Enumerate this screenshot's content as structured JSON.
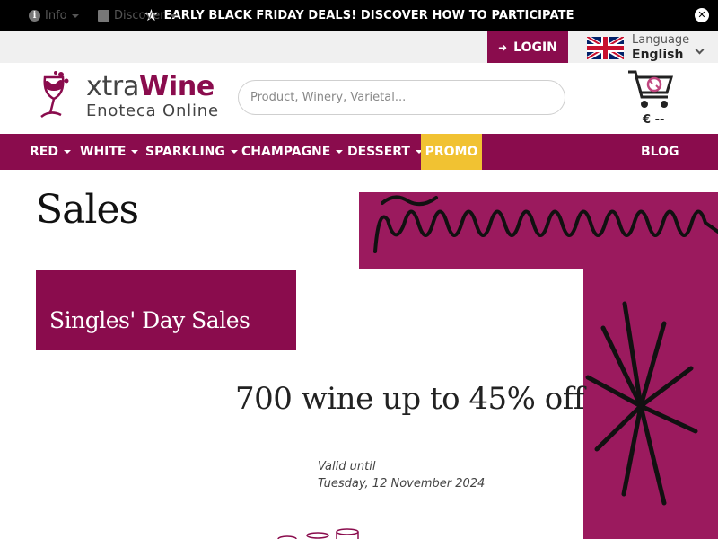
{
  "promo_bar": {
    "star": "★",
    "text": "EARLY BLACK FRIDAY DEALS! DISCOVER HOW TO PARTICIPATE",
    "close": "✕"
  },
  "util_bar": {
    "info_label": "Info",
    "discover_label": "Discover",
    "login_label": "LOGIN",
    "language_title": "Language",
    "language_value": "English"
  },
  "header": {
    "logo_word_a": "xtra",
    "logo_word_b": "Wine",
    "logo_sub": "Enoteca Online",
    "search_placeholder": "Product, Winery, Varietal...",
    "cart_total": "€ --"
  },
  "nav": {
    "items": [
      {
        "label": "RED"
      },
      {
        "label": "WHITE"
      },
      {
        "label": "SPARKLING"
      },
      {
        "label": "CHAMPAGNE"
      },
      {
        "label": "DESSERT"
      },
      {
        "label": "PROMO"
      },
      {
        "label": "BLOG"
      }
    ]
  },
  "content": {
    "title": "Sales",
    "promo_box": "Singles' Day Sales",
    "headline": "700 wine up to 45% off",
    "valid_label": "Valid until",
    "valid_date": "Tuesday, 12 November 2024"
  },
  "colors": {
    "brand": "#8a0c4d",
    "promo": "#f1c232",
    "art_bg": "#9b1a5e"
  }
}
